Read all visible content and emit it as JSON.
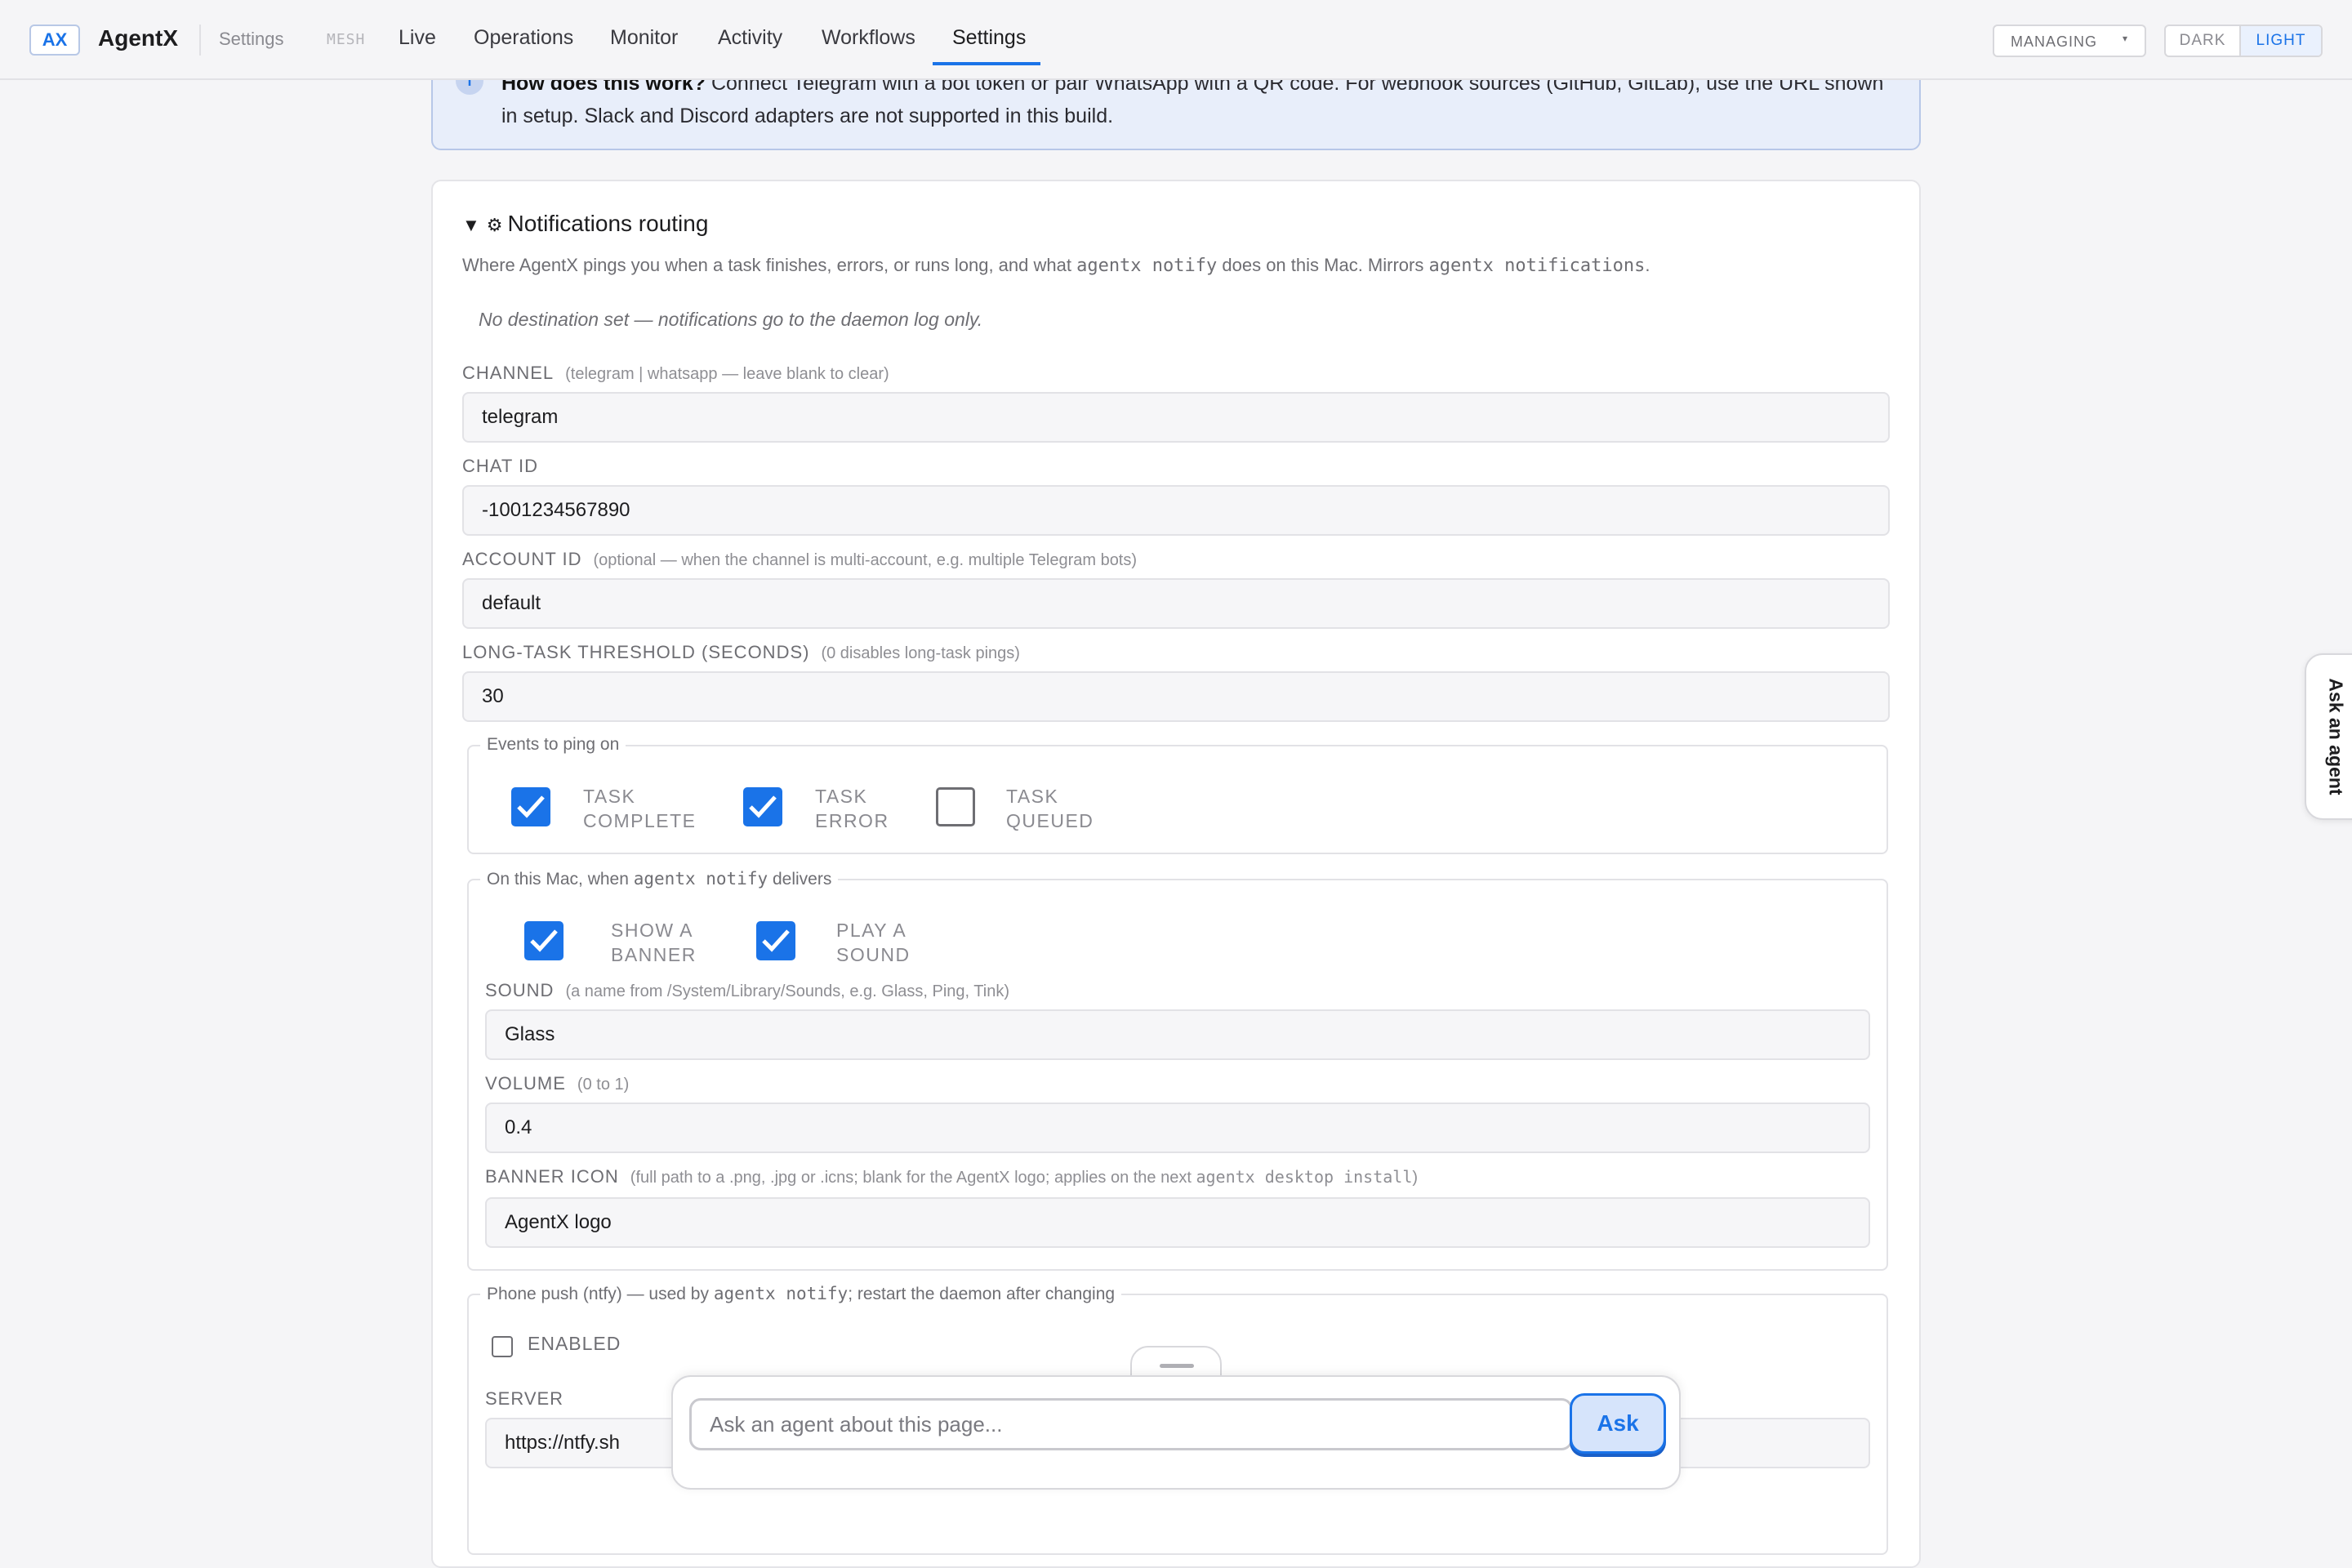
{
  "header": {
    "logo": "AX",
    "app_name": "AgentX",
    "breadcrumb": "Settings",
    "mesh_label": "MESH",
    "tabs": [
      "Live",
      "Operations",
      "Monitor",
      "Activity",
      "Workflows",
      "Settings"
    ],
    "active_tab": "Settings",
    "managing_label": "MANAGING",
    "theme_dark": "DARK",
    "theme_light": "LIGHT",
    "theme_selected": "LIGHT"
  },
  "info_banner": {
    "icon": "info-icon",
    "bold": "How does this work?",
    "line1": " Connect Telegram with a bot token or pair WhatsApp with a QR code. For webhook sources (GitHub, GitLab), use the URL shown",
    "line2": "in setup. Slack and Discord adapters are not supported in this build."
  },
  "section": {
    "expanded_icon": "▼",
    "gear_icon": "⚙",
    "title": "Notifications routing",
    "desc_1": "Where AgentX pings you when a task finishes, errors, or runs long, and what ",
    "desc_code_1": "agentx notify",
    "desc_2": " does on this Mac. Mirrors ",
    "desc_code_2": "agentx notifications",
    "desc_3": ".",
    "note": "No destination set — notifications go to the daemon log only."
  },
  "fields": {
    "channel": {
      "label": "CHANNEL",
      "hint": "(telegram | whatsapp — leave blank to clear)",
      "value": "telegram"
    },
    "chat_id": {
      "label": "CHAT ID",
      "value": "-1001234567890"
    },
    "account_id": {
      "label": "ACCOUNT ID",
      "hint": "(optional — when the channel is multi-account, e.g. multiple Telegram bots)",
      "value": "default"
    },
    "threshold": {
      "label": "LONG-TASK THRESHOLD (SECONDS)",
      "hint": "(0 disables long-task pings)",
      "value": "30"
    }
  },
  "events": {
    "legend": "Events to ping on",
    "items": [
      {
        "line1": "TASK",
        "line2": "COMPLETE",
        "checked": true
      },
      {
        "line1": "TASK",
        "line2": "ERROR",
        "checked": true
      },
      {
        "line1": "TASK",
        "line2": "QUEUED",
        "checked": false
      }
    ]
  },
  "mac": {
    "legend_1": "On this Mac, when ",
    "legend_code": "agentx notify",
    "legend_2": " delivers",
    "options": [
      {
        "line1": "SHOW A",
        "line2": "BANNER",
        "checked": true
      },
      {
        "line1": "PLAY A",
        "line2": "SOUND",
        "checked": true
      }
    ],
    "sound": {
      "label": "SOUND",
      "hint": "(a name from /System/Library/Sounds, e.g. Glass, Ping, Tink)",
      "value": "Glass"
    },
    "volume": {
      "label": "VOLUME",
      "hint": "(0 to 1)",
      "value": "0.4"
    },
    "banner_icon": {
      "label": "BANNER ICON",
      "hint_1": "(full path to a .png, .jpg or .icns; blank for the AgentX logo; applies on the next ",
      "hint_code": "agentx desktop install",
      "hint_2": ")",
      "value": "AgentX logo"
    }
  },
  "ntfy": {
    "legend_1": "Phone push (ntfy) — used by ",
    "legend_code": "agentx notify",
    "legend_2": "; restart the daemon after changing",
    "enabled_label": "ENABLED",
    "enabled": false,
    "server_label": "SERVER",
    "server_value": "https://ntfy.sh"
  },
  "side_tab": {
    "label": "Ask an agent"
  },
  "ask_bar": {
    "placeholder": "Ask an agent about this page...",
    "button": "Ask"
  },
  "colors": {
    "accent": "#1a73e8",
    "banner_bg": "#e8eefa",
    "page_bg": "#f5f5f7"
  }
}
